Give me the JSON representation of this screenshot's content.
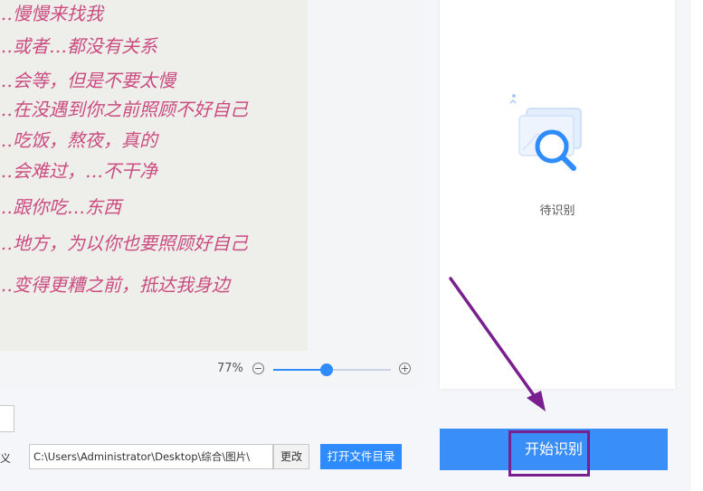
{
  "preview": {
    "handwriting_lines": [
      "…慢慢来找我",
      "…或者…都没有关系",
      "…会等，但是不要太慢",
      "…在没遇到你之前照顾不好自己",
      "…吃饭，熬夜，真的",
      "…会难过，…不干净",
      "…跟你吃…东西",
      "…地方，为以你也要照顾好自己",
      "…变得更糟之前，抵达我身边"
    ],
    "zoom_percent": "77%",
    "zoom_level": 0.45
  },
  "result_panel": {
    "icon": "image-search-icon",
    "status": "待识别"
  },
  "output": {
    "label_fragment": "义",
    "path_value": "C:\\Users\\Administrator\\Desktop\\综合\\图片\\",
    "change_label": "更改",
    "open_dir_label": "打开文件目录"
  },
  "actions": {
    "start_label": "开始识别"
  },
  "colors": {
    "accent": "#2f8cff",
    "start_button": "#3a8ef7",
    "annotation": "#7a1f8f",
    "ink": "#c4306e"
  }
}
